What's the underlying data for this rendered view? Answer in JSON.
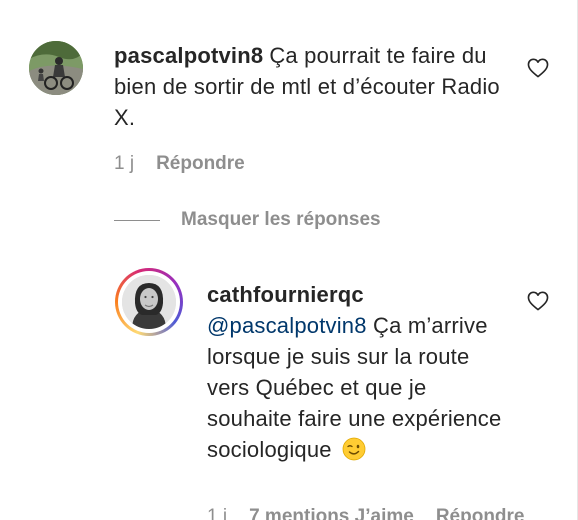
{
  "comments": [
    {
      "username": "pascalpotvin8",
      "text": "Ça pourrait te faire du bien de sortir de mtl et d’écouter Radio X.",
      "time": "1 j",
      "reply_label": "Répondre"
    }
  ],
  "replies_toggle": {
    "label": "Masquer les réponses"
  },
  "replies": [
    {
      "username": "cathfournierqc",
      "mention": "@pascalpotvin8",
      "text": "Ça m’arrive lorsque je suis sur la route vers Québec et que je souhaite faire une expérience sociologique",
      "time": "1 j",
      "mentions_count": "7 mentions J’aime",
      "reply_label": "Répondre"
    }
  ],
  "icons": {
    "like": "heart-outline-icon",
    "emoji": "winking-face-emoji"
  },
  "colors": {
    "text": "#262626",
    "muted": "#8e8e8e",
    "mention": "#00376b",
    "story_ring": [
      "#feda75",
      "#fa7e1e",
      "#d62976",
      "#962fbf",
      "#4f5bd5"
    ]
  }
}
